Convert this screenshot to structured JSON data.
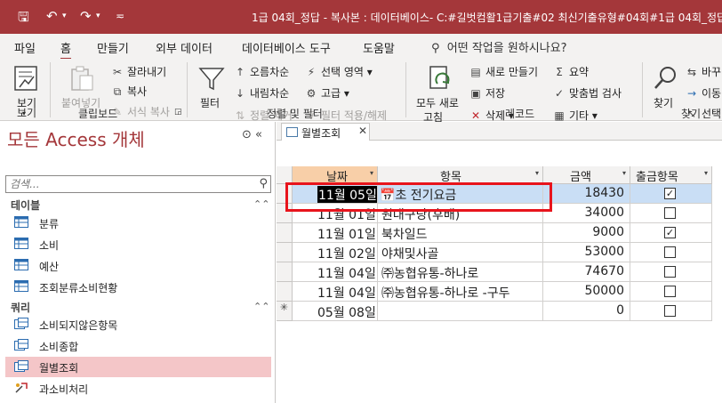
{
  "titlebar": {
    "title": "1급 04회_정답 - 복사본 : 데이터베이스- C:#길벗컴활1급기출#02 최신기출유형#04회#1급 04회_정답 - ...",
    "save_icon": "save-icon",
    "undo_icon": "undo-icon",
    "redo_icon": "redo-icon"
  },
  "menu": {
    "tabs": [
      "파일",
      "홈",
      "만들기",
      "외부 데이터",
      "데이터베이스 도구",
      "도움말"
    ],
    "active": "홈",
    "search": "어떤 작업을 원하시나요?"
  },
  "ribbon": {
    "view": {
      "label": "보기",
      "group": "보기"
    },
    "clipboard": {
      "paste": "붙여넣기",
      "cut": "잘라내기",
      "copy": "복사",
      "format_painter": "서식 복사",
      "group": "클립보드"
    },
    "sort_filter": {
      "filter": "필터",
      "ascending": "오름차순",
      "descending": "내림차순",
      "remove_sort": "정렬 제거",
      "selection": "선택 영역",
      "advanced": "고급",
      "toggle_filter": "필터 적용/해제",
      "group": "정렬 및 필터"
    },
    "records": {
      "refresh_all_1": "모두 새로",
      "refresh_all_2": "고침",
      "new": "새로 만들기",
      "save": "저장",
      "delete": "삭제",
      "totals": "요약",
      "spelling": "맞춤법 검사",
      "more": "기타",
      "group": "레코드"
    },
    "find": {
      "find": "찾기",
      "replace": "바꾸",
      "goto": "이동",
      "select": "선택",
      "group": "찾기"
    }
  },
  "nav": {
    "title": "모든 Access 개체",
    "search_placeholder": "검색...",
    "sections": [
      {
        "label": "테이블",
        "items": [
          "분류",
          "소비",
          "예산",
          "조회분류소비현황"
        ]
      },
      {
        "label": "쿼리",
        "items": [
          "소비되지않은항목",
          "소비종합",
          "월별조회",
          "과소비처리"
        ]
      }
    ],
    "selected": "월별조회"
  },
  "document": {
    "tab_label": "월별조회",
    "columns": [
      "날짜",
      "항목",
      "금액",
      "출금항목"
    ],
    "rows": [
      {
        "date": "11월 05일",
        "item": "초 전기요금",
        "amount": "18430",
        "checked": true
      },
      {
        "date": "11월 01일",
        "item": "원대구당(후배)",
        "amount": "34000",
        "checked": false
      },
      {
        "date": "11월 01일",
        "item": "북차일드",
        "amount": "9000",
        "checked": true
      },
      {
        "date": "11월 02일",
        "item": "야채및사골",
        "amount": "53000",
        "checked": false
      },
      {
        "date": "11월 04일",
        "item": "㈜농협유통-하나로",
        "amount": "74670",
        "checked": false
      },
      {
        "date": "11월 04일",
        "item": "㈜농협유통-하나로 -구두",
        "amount": "50000",
        "checked": false
      },
      {
        "date": "05월 08일",
        "item": "",
        "amount": "0",
        "checked": false,
        "new": true
      }
    ],
    "new_row_marker": "✳"
  },
  "colors": {
    "accent": "#a4373a",
    "selected_row": "#c9def5",
    "nav_selected": "#f4c6c8",
    "highlight_box": "#e8141c"
  }
}
